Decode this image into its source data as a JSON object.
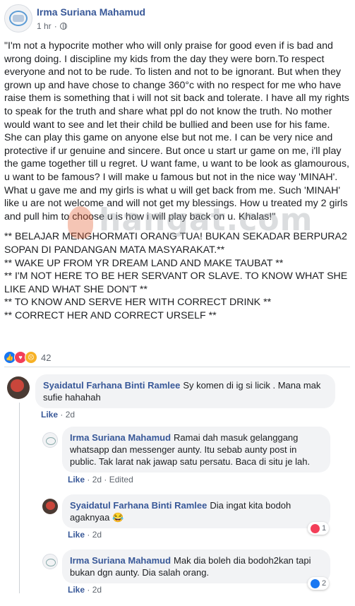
{
  "header": {
    "author": "Irma Suriana Mahamud",
    "time": "1 hr",
    "separator": "·"
  },
  "post": {
    "paragraph": "\"I'm not a hypocrite mother who will only praise for good even if is bad and wrong doing. I discipline my kids from the day they were born.To respect everyone and not to be rude. To listen and not to be ignorant. But when they grown up and have chose to change 360°c with no respect for me who have raise them is something that i will not sit back and tolerate. I have all my rights to speak for the truth and share what ppl do not know the truth. No mother would want to see and let their child be bullied and been use for his fame. She can play this game on anyone else but not me. I can be very nice and protective if ur genuine and sincere. But once u start ur game on me, i'll play the game together till u regret. U want fame, u want to be look as glamourous, u want to be famous? I will make u famous but not in the nice way 'MINAH'. What u gave me and my girls is what u will get back from me. Such 'MINAH' like u are not welcome and will not get my blessings. How u treated my 2 girls and pull him to choose u is how i will play back on u. Khalas!\"",
    "lines": [
      "** BELAJAR MENGHORMATI ORANG TUA! BUKAN SEKADAR BERPURA2 SOPAN DI PANDANGAN MATA MASYARAKAT.**",
      "** WAKE UP FROM YR DREAM LAND AND MAKE TAUBAT **",
      "** I'M NOT HERE TO BE HER SERVANT OR SLAVE. TO KNOW WHAT SHE LIKE AND WHAT SHE DON'T **",
      "** TO KNOW AND SERVE HER WITH CORRECT DRINK **",
      "** CORRECT HER AND CORRECT URSELF **"
    ]
  },
  "watermark": {
    "text": "hangat.com"
  },
  "reactions": {
    "count": "42",
    "icons": [
      "like-icon",
      "love-icon",
      "sad-icon"
    ]
  },
  "comments": [
    {
      "name": "Syaidatul Farhana Binti Ramlee",
      "text": "Sy komen di ig si licik . Mana mak sufie hahahah",
      "like": "Like",
      "time": "2d"
    },
    {
      "name": "Irma Suriana Mahamud",
      "text": "Ramai dah masuk gelanggang whatsapp dan messenger aunty. Itu sebab aunty post in public. Tak larat nak jawap satu persatu. Baca di situ je lah.",
      "like": "Like",
      "time": "2d",
      "edited": "Edited"
    },
    {
      "name": "Syaidatul Farhana Binti Ramlee",
      "text": "Dia ingat kita bodoh agaknyaa 😂",
      "like": "Like",
      "time": "2d",
      "reaction_count": "1"
    },
    {
      "name": "Irma Suriana Mahamud",
      "text": "Mak dia boleh dia bodoh2kan tapi bukan dgn aunty. Dia salah orang.",
      "like": "Like",
      "time": "2d",
      "reaction_count": "2"
    }
  ],
  "colors": {
    "link": "#385898",
    "bubble": "#f2f3f5",
    "like": "#1877f2",
    "love": "#f33e58",
    "sad": "#f7b125"
  }
}
